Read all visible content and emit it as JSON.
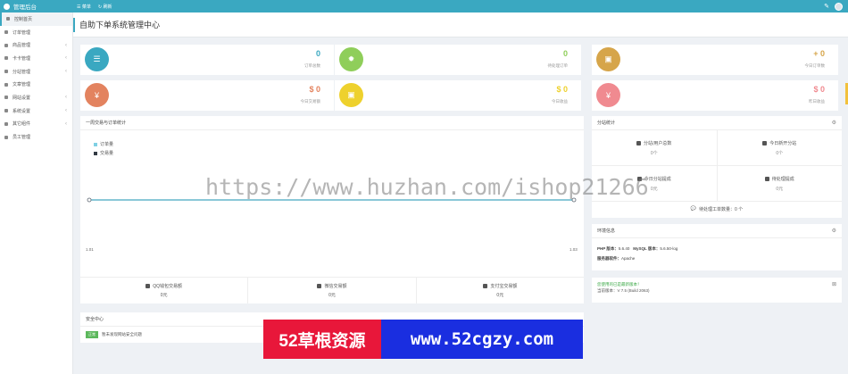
{
  "topbar": {
    "brand": "管理后台",
    "nav": [
      "菜单",
      "刷新"
    ]
  },
  "sidebar": {
    "items": [
      {
        "label": "控制首页",
        "icon": "home-icon",
        "expandable": false,
        "active": true
      },
      {
        "label": "订单管理",
        "icon": "list-icon",
        "expandable": false,
        "active": false
      },
      {
        "label": "商品管理",
        "icon": "box-icon",
        "expandable": true,
        "active": false
      },
      {
        "label": "卡卡管理",
        "icon": "card-icon",
        "expandable": true,
        "active": false
      },
      {
        "label": "分站管理",
        "icon": "sitemap-icon",
        "expandable": true,
        "active": false
      },
      {
        "label": "文章管理",
        "icon": "file-icon",
        "expandable": false,
        "active": false
      },
      {
        "label": "网站设置",
        "icon": "gear-icon",
        "expandable": true,
        "active": false
      },
      {
        "label": "系统设置",
        "icon": "settings-icon",
        "expandable": true,
        "active": false
      },
      {
        "label": "其它组件",
        "icon": "puzzle-icon",
        "expandable": true,
        "active": false
      },
      {
        "label": "员工管理",
        "icon": "user-icon",
        "expandable": false,
        "active": false
      }
    ]
  },
  "page": {
    "title": "自助下单系统管理中心"
  },
  "stats": [
    {
      "value": "0",
      "label": "订单总数",
      "color": "#3aa8c1",
      "icon": "list-icon"
    },
    {
      "value": "0",
      "label": "待处理订单",
      "color": "#8fce5a",
      "icon": "gear-icon"
    },
    {
      "value": "+ 0",
      "label": "今日订单数",
      "color": "#d6a54a",
      "icon": "briefcase-icon"
    },
    {
      "value": "$ 0",
      "label": "今日交易额",
      "color": "#e3835f",
      "icon": "yen-icon"
    },
    {
      "value": "$ 0",
      "label": "今日收益",
      "color": "#eed12d",
      "icon": "briefcase-icon"
    },
    {
      "value": "$ 0",
      "label": "昨日收益",
      "color": "#f08a90",
      "icon": "yen-icon"
    }
  ],
  "chart_panel": {
    "title": "一周交易与订单统计",
    "legend": [
      "订单量",
      "交易量"
    ],
    "legend_colors": [
      "#7fd0e4",
      "#333a44"
    ]
  },
  "chart_data": {
    "type": "line",
    "x": [
      "1.01",
      "1.02",
      "1.03",
      "1.04",
      "1.05",
      "1.06",
      "1.07"
    ],
    "series": [
      {
        "name": "订单量",
        "values": [
          0,
          0,
          0,
          0,
          0,
          0,
          0
        ]
      },
      {
        "name": "交易量",
        "values": [
          0,
          0,
          0,
          0,
          0,
          0,
          0
        ]
      }
    ],
    "x_tick_labels": [
      "1.01",
      "1.03"
    ]
  },
  "money_row": [
    {
      "label": "QQ钱包交易额",
      "value": "0元",
      "icon": "qq-icon"
    },
    {
      "label": "微信交易额",
      "value": "0元",
      "icon": "wechat-icon"
    },
    {
      "label": "支付宝交易额",
      "value": "0元",
      "icon": "alipay-icon"
    }
  ],
  "branch_panel": {
    "title": "分站统计",
    "cells": [
      {
        "label": "分站/用户总数",
        "value": "0个",
        "icon": "sitemap-icon"
      },
      {
        "label": "今日新开分站",
        "value": "0个",
        "icon": "cloud-icon"
      },
      {
        "label": "今日分站提成",
        "value": "0元",
        "icon": "yen-icon"
      },
      {
        "label": "待处理提成",
        "value": "0元",
        "icon": "money-icon"
      }
    ],
    "footer": "待处理工单数量：0 个"
  },
  "env_panel": {
    "title": "环境信息",
    "php_label": "PHP 版本：",
    "php_value": "5.6.40",
    "mysql_label": "MySQL 版本：",
    "mysql_value": "5.6.50-log",
    "server_label": "服务器软件：",
    "server_value": "Apache"
  },
  "update_panel": {
    "line1": "您使用的已是最新版本！",
    "line2": "当前版本：V 7.5 (Build 2063)"
  },
  "security_panel": {
    "title": "安全中心",
    "tag": "正常",
    "message": "暂未发现网站安全问题"
  },
  "overlay": {
    "watermark": "https://www.huzhan.com/ishop21266",
    "promo_left": "52草根资源",
    "promo_right": "www.52cgzy.com"
  }
}
